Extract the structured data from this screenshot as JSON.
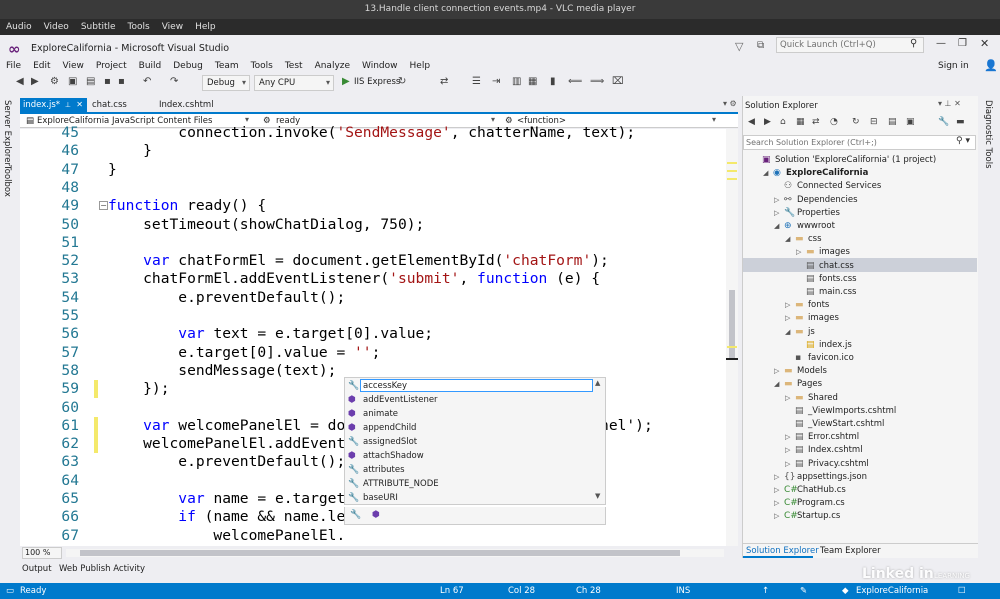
{
  "vlc": {
    "title": "13.Handle client connection events.mp4 - VLC media player",
    "menu": [
      "Audio",
      "Video",
      "Subtitle",
      "Tools",
      "View",
      "Help"
    ]
  },
  "vs": {
    "title": "ExploreCalifornia - Microsoft Visual Studio",
    "menu": [
      "File",
      "Edit",
      "View",
      "Project",
      "Build",
      "Debug",
      "Team",
      "Tools",
      "Test",
      "Analyze",
      "Window",
      "Help"
    ],
    "quick_launch_placeholder": "Quick Launch (Ctrl+Q)",
    "sign_in": "Sign in"
  },
  "toolbar": {
    "config": "Debug",
    "platform": "Any CPU",
    "run_target": "IIS Express"
  },
  "left_tabs": [
    "Server Explorer",
    "Toolbox"
  ],
  "right_tabs": [
    "Diagnostic Tools"
  ],
  "doc_tabs": [
    {
      "label": "index.js*",
      "active": true
    },
    {
      "label": "chat.css",
      "active": false
    },
    {
      "label": "Index.cshtml",
      "active": false
    }
  ],
  "navbar": {
    "project": "ExploreCalifornia JavaScript Content Files",
    "scope": "ready",
    "member": "<function>"
  },
  "code": {
    "lines": [
      {
        "n": "45",
        "text": "        connection.invoke('SendMessage', chatterName, text);"
      },
      {
        "n": "46",
        "text": "    }"
      },
      {
        "n": "47",
        "text": "}"
      },
      {
        "n": "48",
        "text": ""
      },
      {
        "n": "49",
        "text": "function ready() {"
      },
      {
        "n": "50",
        "text": "    setTimeout(showChatDialog, 750);"
      },
      {
        "n": "51",
        "text": ""
      },
      {
        "n": "52",
        "text": "    var chatFormEl = document.getElementById('chatForm');"
      },
      {
        "n": "53",
        "text": "    chatFormEl.addEventListener('submit', function (e) {"
      },
      {
        "n": "54",
        "text": "        e.preventDefault();"
      },
      {
        "n": "55",
        "text": ""
      },
      {
        "n": "56",
        "text": "        var text = e.target[0].value;"
      },
      {
        "n": "57",
        "text": "        e.target[0].value = '';"
      },
      {
        "n": "58",
        "text": "        sendMessage(text);"
      },
      {
        "n": "59",
        "text": "    });"
      },
      {
        "n": "60",
        "text": ""
      },
      {
        "n": "61",
        "text": "    var welcomePanelEl = do                      lcomePanel');"
      },
      {
        "n": "62",
        "text": "    welcomePanelEl.addEvent                      e) {"
      },
      {
        "n": "63",
        "text": "        e.preventDefault();"
      },
      {
        "n": "64",
        "text": ""
      },
      {
        "n": "65",
        "text": "        var name = e.target"
      },
      {
        "n": "66",
        "text": "        if (name && name.le"
      },
      {
        "n": "67",
        "text": "            welcomePanelEl."
      }
    ]
  },
  "intellisense": {
    "items": [
      {
        "label": "accessKey",
        "icon": "wrench"
      },
      {
        "label": "addEventListener",
        "icon": "method"
      },
      {
        "label": "animate",
        "icon": "method"
      },
      {
        "label": "appendChild",
        "icon": "method"
      },
      {
        "label": "assignedSlot",
        "icon": "wrench"
      },
      {
        "label": "attachShadow",
        "icon": "method"
      },
      {
        "label": "attributes",
        "icon": "wrench"
      },
      {
        "label": "ATTRIBUTE_NODE",
        "icon": "wrench"
      },
      {
        "label": "baseURI",
        "icon": "wrench"
      }
    ]
  },
  "editor": {
    "zoom": "100 %"
  },
  "bottom_tabs": [
    "Output",
    "Web Publish Activity"
  ],
  "solution_explorer": {
    "title": "Solution Explorer",
    "search_placeholder": "Search Solution Explorer (Ctrl+;)",
    "items": [
      {
        "label": "Solution 'ExploreCalifornia' (1 project)",
        "depth": 0,
        "exp": "",
        "icon": "solution-icon"
      },
      {
        "label": "ExploreCalifornia",
        "depth": 1,
        "exp": "◢",
        "icon": "project-icon",
        "bold": true
      },
      {
        "label": "Connected Services",
        "depth": 2,
        "exp": "",
        "icon": "connected-services-icon"
      },
      {
        "label": "Dependencies",
        "depth": 2,
        "exp": "▷",
        "icon": "dependencies-icon"
      },
      {
        "label": "Properties",
        "depth": 2,
        "exp": "▷",
        "icon": "properties-icon"
      },
      {
        "label": "wwwroot",
        "depth": 2,
        "exp": "◢",
        "icon": "globe-icon"
      },
      {
        "label": "css",
        "depth": 3,
        "exp": "◢",
        "icon": "folder-icon"
      },
      {
        "label": "images",
        "depth": 4,
        "exp": "▷",
        "icon": "folder-icon"
      },
      {
        "label": "chat.css",
        "depth": 4,
        "exp": "",
        "icon": "css-file-icon",
        "selected": true
      },
      {
        "label": "fonts.css",
        "depth": 4,
        "exp": "",
        "icon": "css-file-icon"
      },
      {
        "label": "main.css",
        "depth": 4,
        "exp": "",
        "icon": "css-file-icon"
      },
      {
        "label": "fonts",
        "depth": 3,
        "exp": "▷",
        "icon": "folder-icon"
      },
      {
        "label": "images",
        "depth": 3,
        "exp": "▷",
        "icon": "folder-icon"
      },
      {
        "label": "js",
        "depth": 3,
        "exp": "◢",
        "icon": "folder-icon"
      },
      {
        "label": "index.js",
        "depth": 4,
        "exp": "",
        "icon": "js-file-icon"
      },
      {
        "label": "favicon.ico",
        "depth": 3,
        "exp": "",
        "icon": "ico-file-icon"
      },
      {
        "label": "Models",
        "depth": 2,
        "exp": "▷",
        "icon": "folder-icon"
      },
      {
        "label": "Pages",
        "depth": 2,
        "exp": "◢",
        "icon": "folder-icon"
      },
      {
        "label": "Shared",
        "depth": 3,
        "exp": "▷",
        "icon": "folder-icon"
      },
      {
        "label": "_ViewImports.cshtml",
        "depth": 3,
        "exp": "",
        "icon": "cshtml-file-icon"
      },
      {
        "label": "_ViewStart.cshtml",
        "depth": 3,
        "exp": "",
        "icon": "cshtml-file-icon"
      },
      {
        "label": "Error.cshtml",
        "depth": 3,
        "exp": "▷",
        "icon": "cshtml-file-icon"
      },
      {
        "label": "Index.cshtml",
        "depth": 3,
        "exp": "▷",
        "icon": "cshtml-file-icon"
      },
      {
        "label": "Privacy.cshtml",
        "depth": 3,
        "exp": "▷",
        "icon": "cshtml-file-icon"
      },
      {
        "label": "appsettings.json",
        "depth": 2,
        "exp": "▷",
        "icon": "json-file-icon"
      },
      {
        "label": "ChatHub.cs",
        "depth": 2,
        "exp": "▷",
        "icon": "cs-file-icon"
      },
      {
        "label": "Program.cs",
        "depth": 2,
        "exp": "▷",
        "icon": "cs-file-icon"
      },
      {
        "label": "Startup.cs",
        "depth": 2,
        "exp": "▷",
        "icon": "cs-file-icon"
      }
    ],
    "bottom_tabs": [
      "Solution Explorer",
      "Team Explorer"
    ]
  },
  "status": {
    "state": "Ready",
    "line": "Ln 67",
    "col": "Col 28",
    "ch": "Ch 28",
    "mode": "INS",
    "repo": "ExploreCalifornia"
  },
  "watermark": {
    "brand": "Linked in",
    "sub": "LEARNING"
  },
  "colors": {
    "accent": "#007acc",
    "keyword": "#0000ff",
    "string": "#a31515",
    "line_number": "#237893"
  }
}
